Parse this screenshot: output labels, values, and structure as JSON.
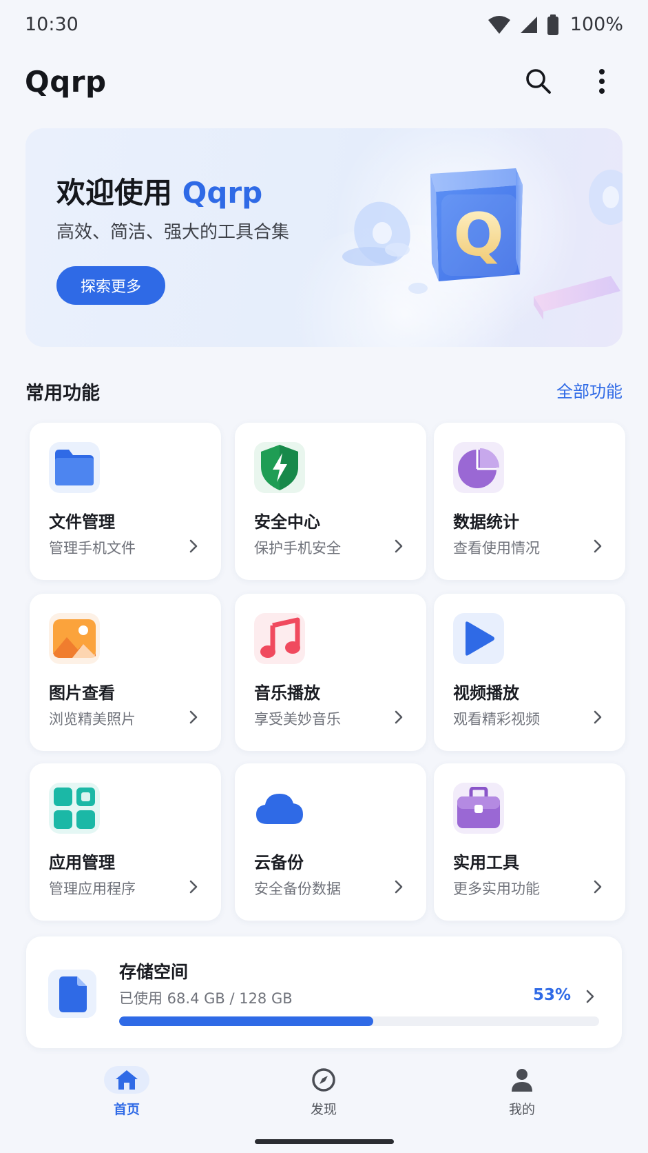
{
  "status_bar": {
    "time": "10:30",
    "battery": "100%"
  },
  "app_bar": {
    "title": "Qqrp"
  },
  "banner": {
    "title_prefix": "欢迎使用 ",
    "title_accent": "Qqrp",
    "subtitle": "高效、简洁、强大的工具合集",
    "button_label": "探索更多",
    "art_letter": "Q"
  },
  "section": {
    "title": "常用功能",
    "link": "全部功能"
  },
  "features": [
    {
      "title": "文件管理",
      "desc": "管理手机文件",
      "icon": "folder-icon"
    },
    {
      "title": "安全中心",
      "desc": "保护手机安全",
      "icon": "shield-icon"
    },
    {
      "title": "数据统计",
      "desc": "查看使用情况",
      "icon": "pie-chart-icon"
    },
    {
      "title": "图片查看",
      "desc": "浏览精美照片",
      "icon": "image-icon"
    },
    {
      "title": "音乐播放",
      "desc": "享受美妙音乐",
      "icon": "music-icon"
    },
    {
      "title": "视频播放",
      "desc": "观看精彩视频",
      "icon": "play-icon"
    },
    {
      "title": "应用管理",
      "desc": "管理应用程序",
      "icon": "apps-grid-icon"
    },
    {
      "title": "云备份",
      "desc": "安全备份数据",
      "icon": "cloud-icon"
    },
    {
      "title": "实用工具",
      "desc": "更多实用功能",
      "icon": "toolbox-icon"
    }
  ],
  "storage": {
    "title": "存储空间",
    "used_text": "已使用 68.4 GB / 128 GB",
    "percent_label": "53%",
    "used_fraction": 0.53
  },
  "bottom_nav": [
    {
      "label": "首页",
      "icon": "home-icon",
      "active": true
    },
    {
      "label": "发现",
      "icon": "compass-icon",
      "active": false
    },
    {
      "label": "我的",
      "icon": "person-icon",
      "active": false
    }
  ],
  "colors": {
    "accent": "#2f6ae6",
    "background": "#f4f6fb"
  }
}
